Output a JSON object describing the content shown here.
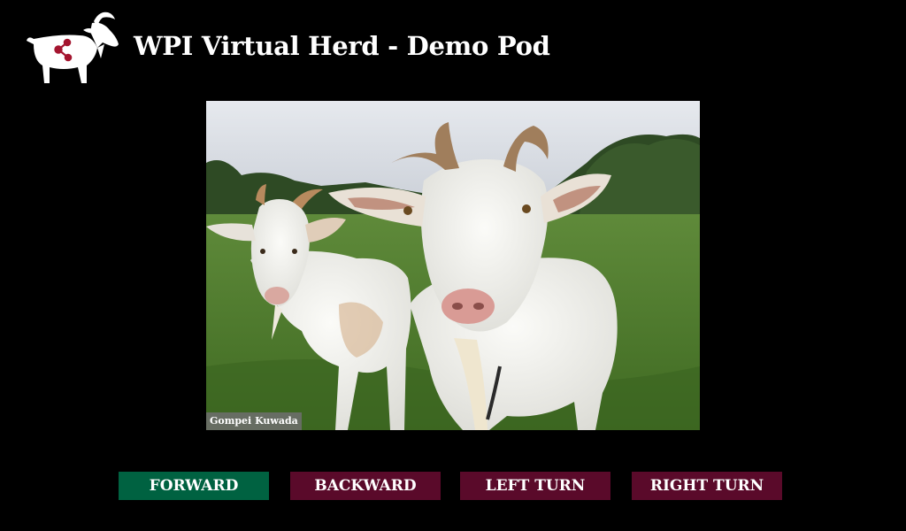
{
  "header": {
    "title": "WPI Virtual Herd - Demo Pod",
    "logo_icon": "goat-icon"
  },
  "camera": {
    "caption": "Gompei Kuwada"
  },
  "controls": {
    "forward": {
      "label": "FORWARD",
      "color": "#006241"
    },
    "backward": {
      "label": "BACKWARD",
      "color": "#5a0a2a"
    },
    "left": {
      "label": "LEFT TURN",
      "color": "#5a0a2a"
    },
    "right": {
      "label": "RIGHT TURN",
      "color": "#5a0a2a"
    }
  },
  "colors": {
    "background": "#000000",
    "logo_accent": "#a4152f"
  }
}
